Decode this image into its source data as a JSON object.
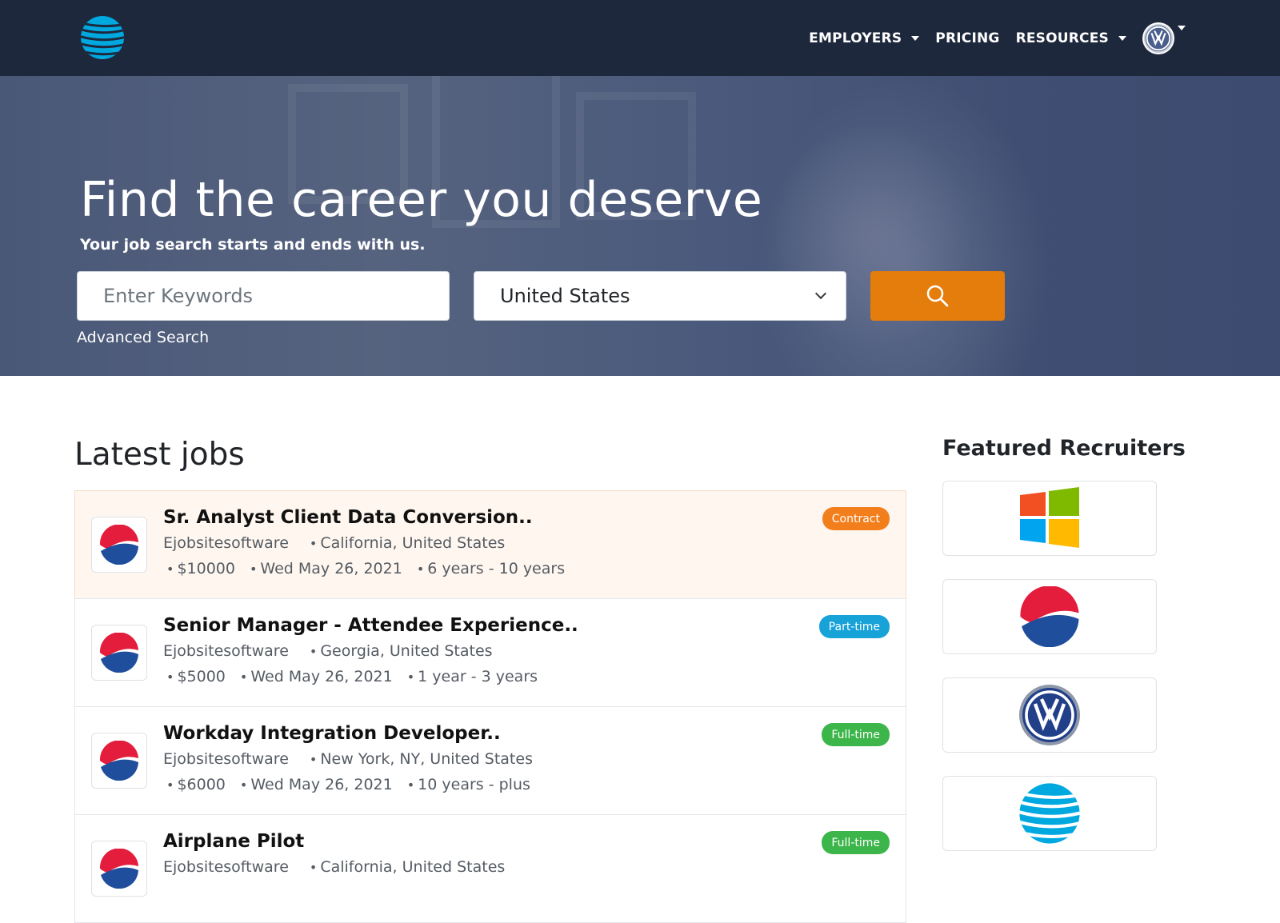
{
  "navbar": {
    "brand_icon": "att-globe-icon",
    "items": [
      {
        "label": "EMPLOYERS",
        "dropdown": true
      },
      {
        "label": "PRICING",
        "dropdown": false
      },
      {
        "label": "RESOURCES",
        "dropdown": true
      }
    ],
    "avatar_icon": "volkswagen-logo-icon"
  },
  "hero": {
    "title": "Find the career you deserve",
    "subtitle": "Your job search starts and ends with us.",
    "keyword_placeholder": "Enter Keywords",
    "country_value": "United States",
    "search_icon": "search-icon",
    "advanced_search": "Advanced Search"
  },
  "latest": {
    "title": "Latest jobs",
    "jobs": [
      {
        "title": "Sr. Analyst Client Data Conversion..",
        "company": "Ejobsitesoftware",
        "location": "California, United States",
        "salary": "$10000",
        "date": "Wed May 26, 2021",
        "experience": "6 years - 10 years",
        "type": "Contract",
        "type_color": "#f37e1c",
        "logo": "pepsi-logo-icon"
      },
      {
        "title": "Senior Manager - Attendee Experience..",
        "company": "Ejobsitesoftware",
        "location": "Georgia, United States",
        "salary": "$5000",
        "date": "Wed May 26, 2021",
        "experience": "1 year - 3 years",
        "type": "Part-time",
        "type_color": "#17a2d8",
        "logo": "pepsi-logo-icon"
      },
      {
        "title": "Workday Integration Developer..",
        "company": "Ejobsitesoftware",
        "location": "New York, NY, United States",
        "salary": "$6000",
        "date": "Wed May 26, 2021",
        "experience": "10 years - plus",
        "type": "Full-time",
        "type_color": "#3cb54a",
        "logo": "pepsi-logo-icon"
      },
      {
        "title": "Airplane Pilot",
        "company": "Ejobsitesoftware",
        "location": "California, United States",
        "salary": "",
        "date": "",
        "experience": "",
        "type": "Full-time",
        "type_color": "#3cb54a",
        "logo": "pepsi-logo-icon"
      }
    ]
  },
  "featured": {
    "title": "Featured Recruiters",
    "recruiters": [
      "windows-logo-icon",
      "pepsi-logo-icon",
      "volkswagen-logo-icon",
      "att-globe-icon"
    ]
  },
  "colors": {
    "navbar": "#1e283c",
    "search_button": "#e57d0c",
    "highlight_row": "#fff7ef"
  }
}
